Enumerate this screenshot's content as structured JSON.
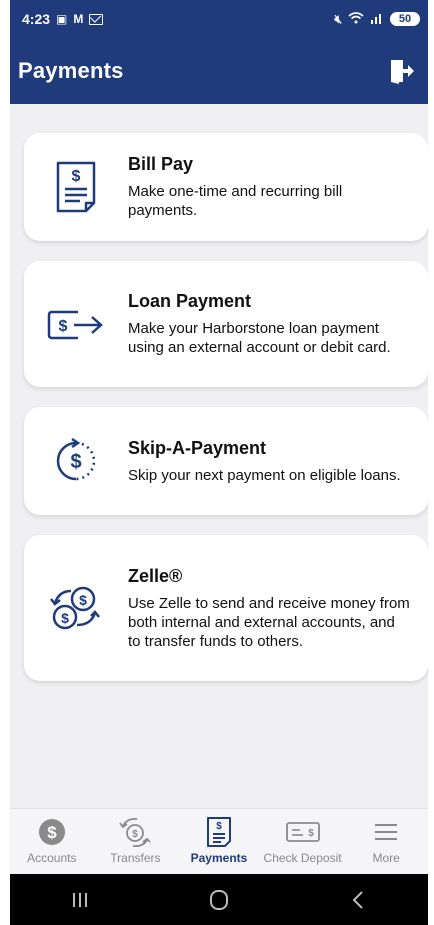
{
  "status_bar": {
    "time": "4:23",
    "battery": "50"
  },
  "app_bar": {
    "title": "Payments"
  },
  "cards": [
    {
      "title": "Bill Pay",
      "description": "Make one-time and recurring bill payments.",
      "icon": "bill-document-icon"
    },
    {
      "title": "Loan Payment",
      "description": "Make your Harborstone loan payment using an external account or debit card.",
      "icon": "loan-transfer-icon"
    },
    {
      "title": "Skip-A-Payment",
      "description": "Skip your next payment on eligible loans.",
      "icon": "skip-payment-icon"
    },
    {
      "title": "Zelle®",
      "description": "Use Zelle to send and receive money from both internal and external accounts, and to transfer funds to others.",
      "icon": "zelle-exchange-icon"
    }
  ],
  "bottom_nav": [
    {
      "label": "Accounts",
      "icon": "dollar-coin-icon",
      "active": false
    },
    {
      "label": "Transfers",
      "icon": "transfer-cycle-icon",
      "active": false
    },
    {
      "label": "Payments",
      "icon": "bill-document-icon",
      "active": true
    },
    {
      "label": "Check Deposit",
      "icon": "check-icon",
      "active": false
    },
    {
      "label": "More",
      "icon": "hamburger-menu-icon",
      "active": false
    }
  ],
  "colors": {
    "primary": "#1f3b7c",
    "background": "#f0f0f2",
    "inactive": "#8a8a8a"
  }
}
